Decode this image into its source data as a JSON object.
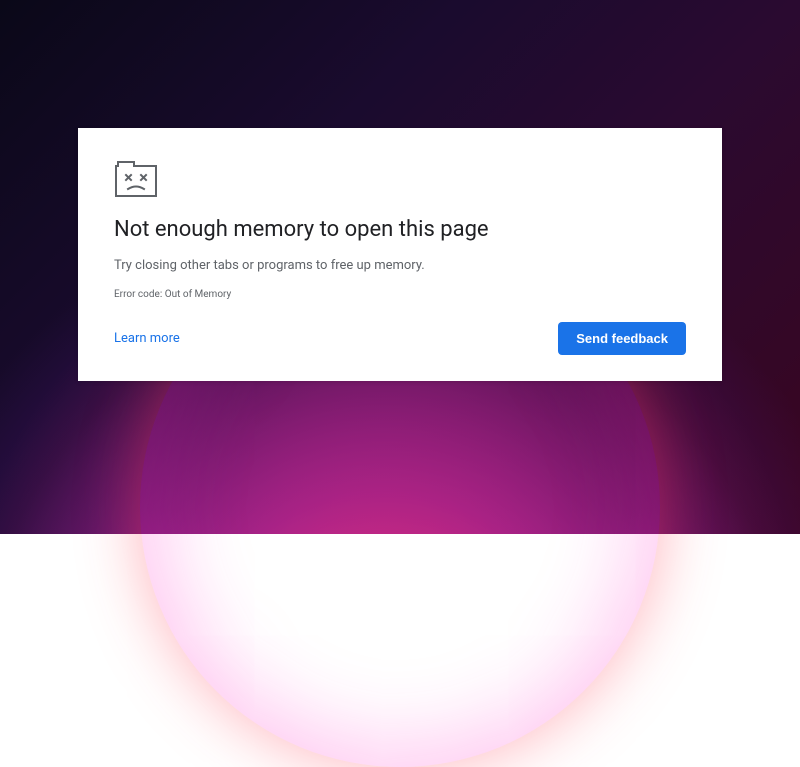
{
  "error": {
    "title": "Not enough memory to open this page",
    "subtitle": "Try closing other tabs or programs to free up memory.",
    "code": "Error code: Out of Memory",
    "learn_more": "Learn more",
    "feedback_button": "Send feedback"
  },
  "colors": {
    "link": "#1a73e8",
    "button_bg": "#1a73e8",
    "button_text": "#ffffff",
    "text_primary": "#202124",
    "text_secondary": "#5f6368"
  }
}
